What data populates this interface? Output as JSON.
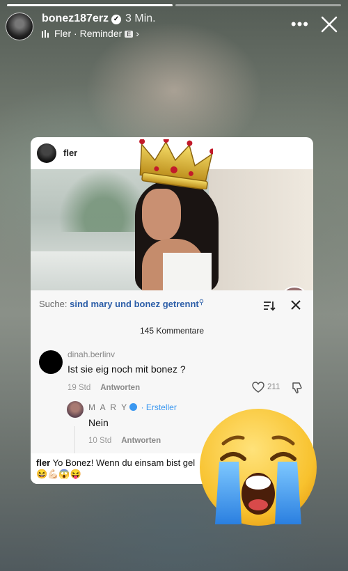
{
  "story": {
    "username": "bonez187erz",
    "time": "3 Min.",
    "music_artist": "Fler",
    "music_title": "Reminder",
    "explicit_badge": "E"
  },
  "card": {
    "post_user": "fler",
    "search_prefix": "Suche:",
    "search_query": "sind mary und bonez getrennt",
    "comment_count": "145 Kommentare",
    "comment": {
      "user": "dinah.berlinv",
      "text": "Ist sie eig noch mit bonez ?",
      "age": "19 Std",
      "reply_label": "Antworten",
      "likes": "211"
    },
    "reply": {
      "user": "M A R Y",
      "creator_tag": "· Ersteller",
      "text": "Nein",
      "age": "10 Std",
      "reply_label": "Antworten"
    },
    "caption_user": "fler",
    "caption_text": "Yo Bonez! Wenn du einsam bist gel",
    "caption_emojis": "😆💪🏻😱😝"
  },
  "icons": [
    "verified-icon",
    "music-bars-icon",
    "chevron-right-icon",
    "more-icon",
    "close-icon",
    "sort-icon",
    "x-icon",
    "heart-icon",
    "dislike-icon",
    "crown-sticker",
    "crying-emoji-sticker"
  ],
  "colors": {
    "link_blue": "#2c5ea8",
    "creator_blue": "#3a97f0",
    "plus_red": "#e8284b"
  }
}
